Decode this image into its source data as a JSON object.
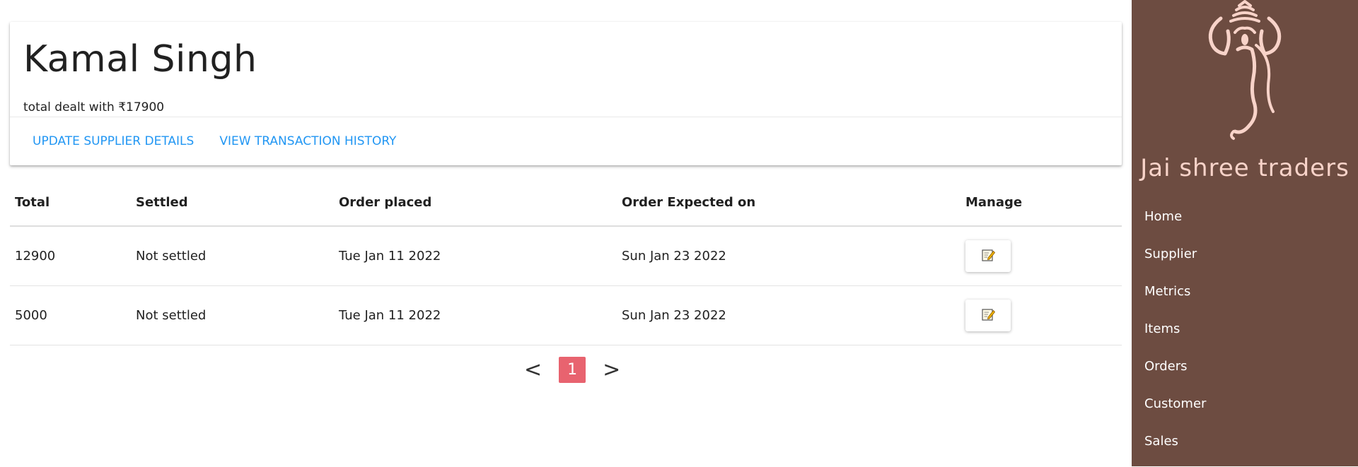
{
  "supplier": {
    "name": "Kamal Singh",
    "total_text": "total dealt with ₹17900",
    "actions": [
      "UPDATE SUPPLIER DETAILS",
      "VIEW TRANSACTION HISTORY"
    ]
  },
  "table": {
    "headers": [
      "Total",
      "Settled",
      "Order placed",
      "Order Expected on",
      "Manage"
    ],
    "rows": [
      [
        "12900",
        "Not settled",
        "Tue Jan 11 2022",
        "Sun Jan 23 2022"
      ],
      [
        "5000",
        "Not settled",
        "Tue Jan 11 2022",
        "Sun Jan 23 2022"
      ]
    ],
    "manage_icon": "edit-note-icon"
  },
  "pagination": {
    "prev": "<",
    "current": "1",
    "next": ">"
  },
  "sidebar": {
    "brand": "Jai shree traders",
    "logo_icon": "ganesha-logo",
    "items": [
      "Home",
      "Supplier",
      "Metrics",
      "Items",
      "Orders",
      "Customer",
      "Sales"
    ]
  },
  "colors": {
    "sidebar_bg": "#6d4c41",
    "brand": "#f8d3c9",
    "link": "#2196f3",
    "page_active": "#e8636f"
  }
}
